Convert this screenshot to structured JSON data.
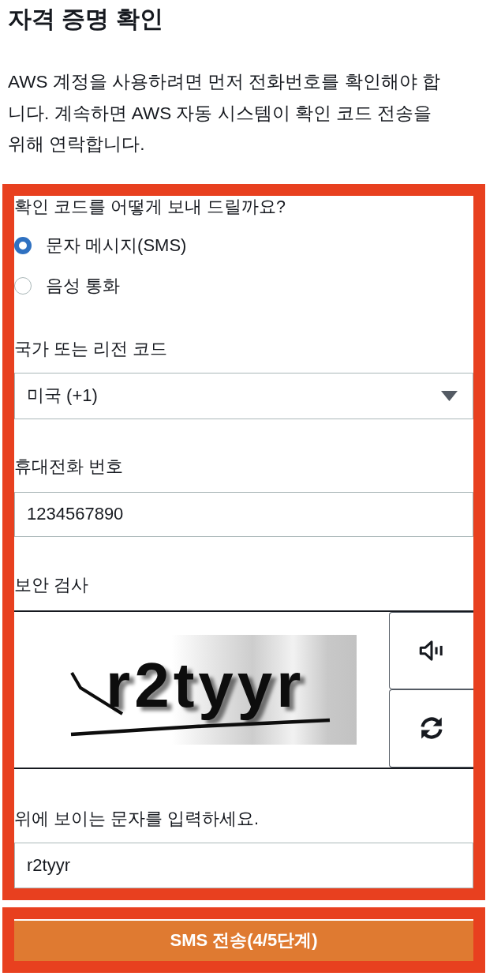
{
  "title": "자격 증명 확인",
  "description": "AWS 계정을 사용하려면 먼저 전화번호를 확인해야 합니다. 계속하면 AWS 자동 시스템이 확인 코드 전송을 위해 연락합니다.",
  "verification_form": {
    "highlighted": true,
    "delivery_method": {
      "label": "확인 코드를 어떻게 보내 드릴까요?",
      "options": [
        {
          "label": "문자 메시지(SMS)",
          "selected": true
        },
        {
          "label": "음성 통화",
          "selected": false
        }
      ]
    },
    "country_code": {
      "label": "국가 또는 리전 코드",
      "value": "미국 (+1)"
    },
    "phone_number": {
      "label": "휴대전화 번호",
      "value": "1234567890"
    },
    "security_check": {
      "label": "보안 검사",
      "captcha_text": "r2tyyr"
    },
    "captcha_answer": {
      "label": "위에 보이는 문자를 입력하세요.",
      "value": "r2tyyr"
    }
  },
  "submit_button": {
    "label": "SMS 전송(4/5단계)",
    "highlighted": true
  }
}
